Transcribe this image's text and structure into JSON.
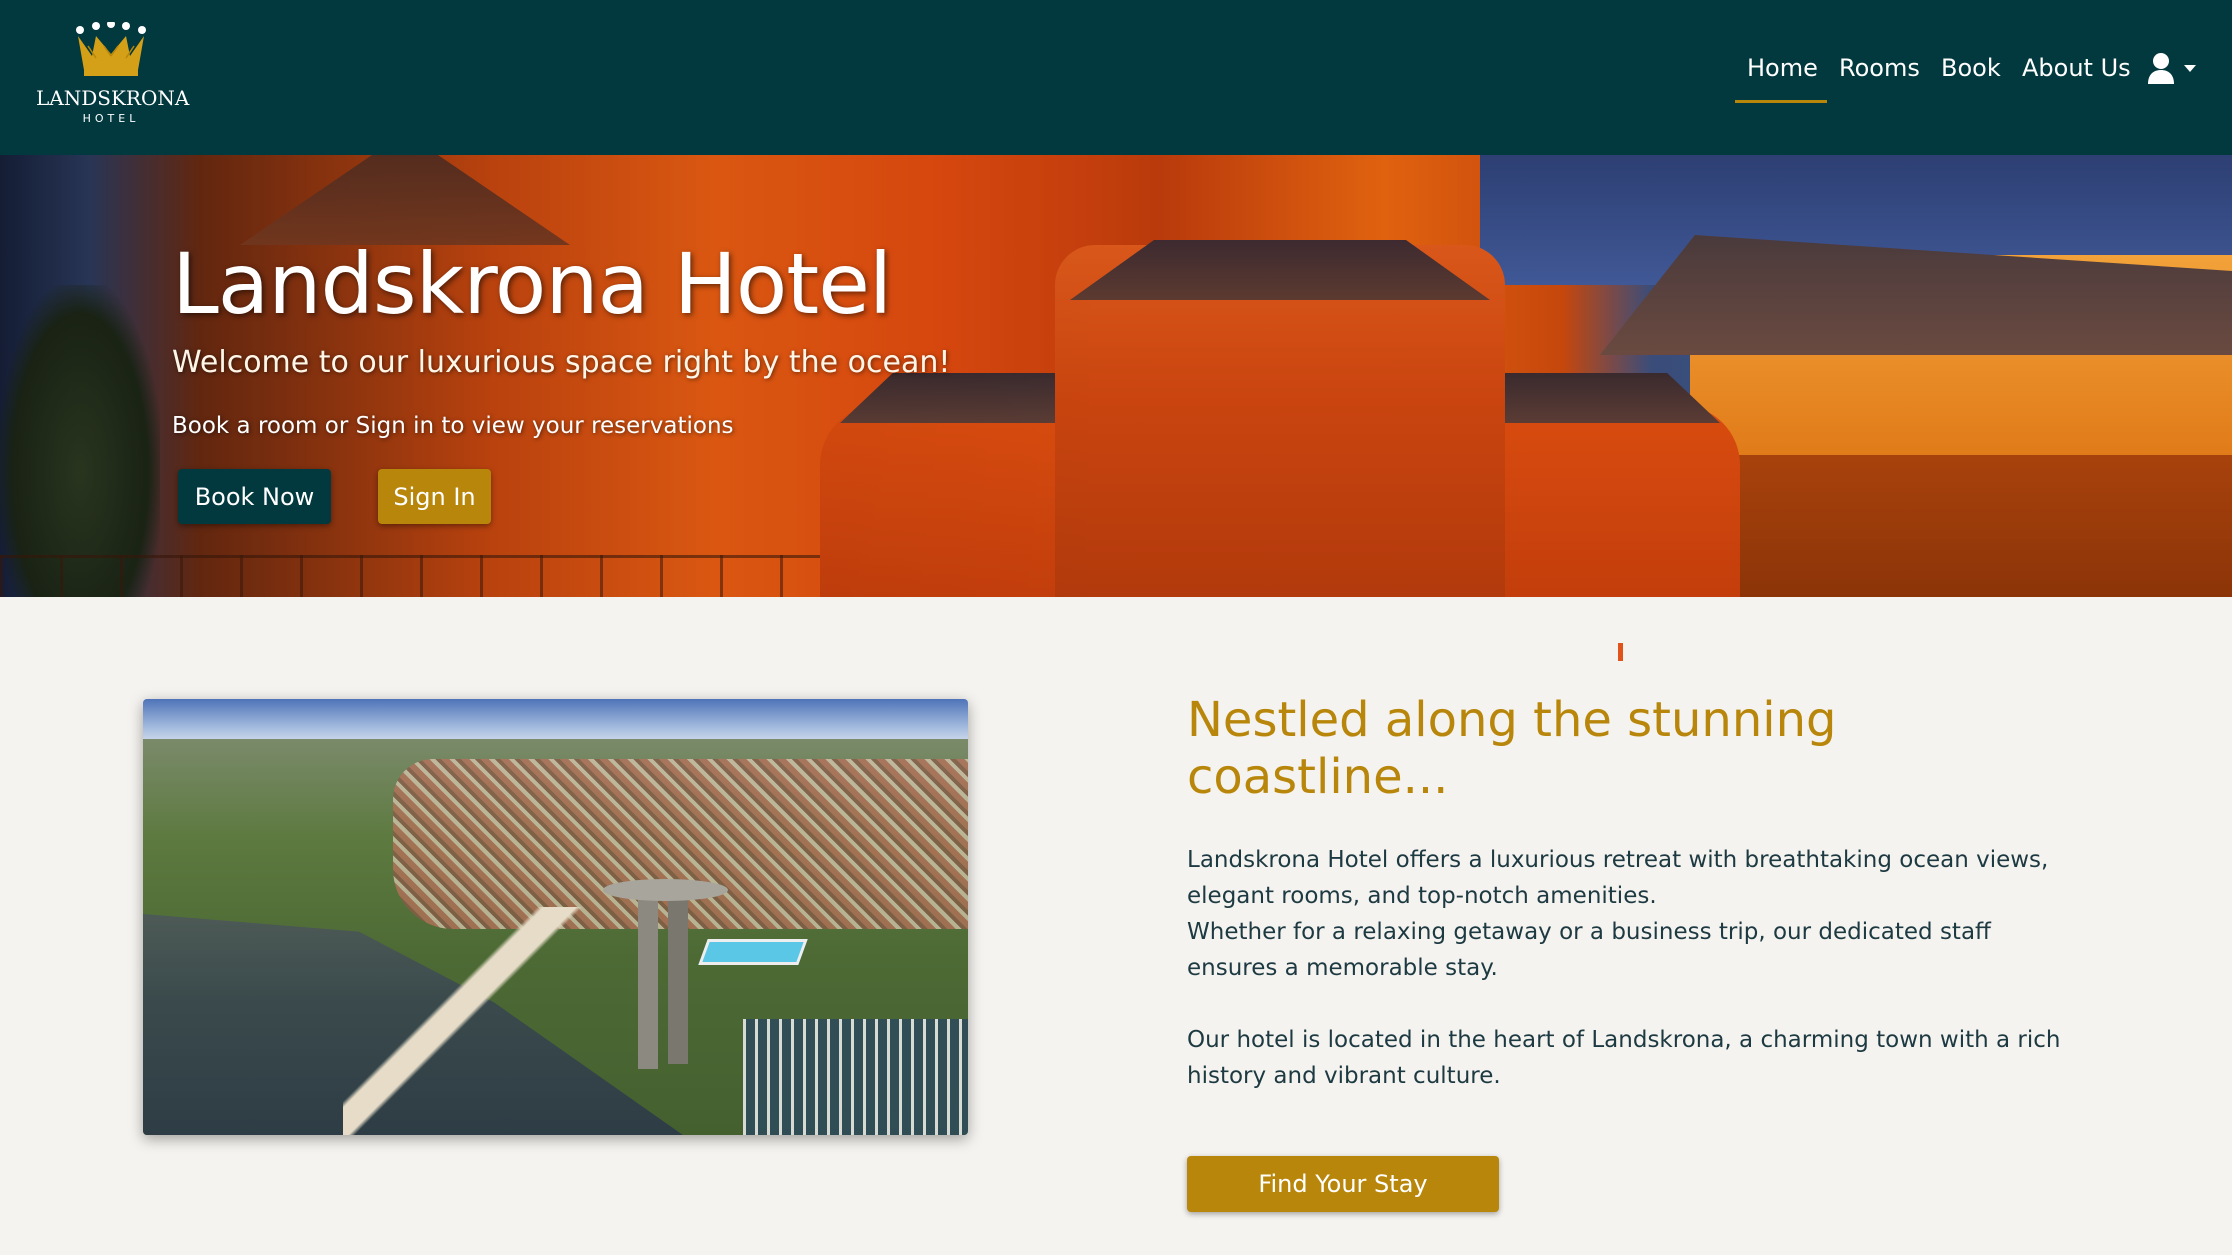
{
  "colors": {
    "navbar_bg": "#02393f",
    "accent_gold": "#b8860b",
    "page_bg": "#f5f3ef",
    "body_text": "#1d3a42"
  },
  "brand": {
    "logo_icon": "crown-icon",
    "name": "LANDSKRONA",
    "subtitle": "HOTEL"
  },
  "nav": {
    "items": [
      {
        "label": "Home",
        "active": true
      },
      {
        "label": "Rooms",
        "active": false
      },
      {
        "label": "Book",
        "active": false
      },
      {
        "label": "About Us",
        "active": false
      }
    ],
    "user_icon": "user-icon",
    "dropdown_icon": "caret-down-icon"
  },
  "hero": {
    "title": "Landskrona Hotel",
    "subtitle": "Welcome to our luxurious space right by the ocean!",
    "note": "Book a room or Sign in to view your reservations",
    "book_button": "Book Now",
    "signin_button": "Sign In"
  },
  "about": {
    "heading": "Nestled along the stunning coastline...",
    "paragraph1_line1": "Landskrona Hotel offers a luxurious retreat with breathtaking ocean views, elegant rooms, and top-notch amenities.",
    "paragraph1_line2": "Whether for a relaxing getaway or a business trip, our dedicated staff ensures a memorable stay.",
    "paragraph2": "Our hotel is located in the heart of Landskrona, a charming town with a rich history and vibrant culture.",
    "cta_button": "Find Your Stay"
  }
}
